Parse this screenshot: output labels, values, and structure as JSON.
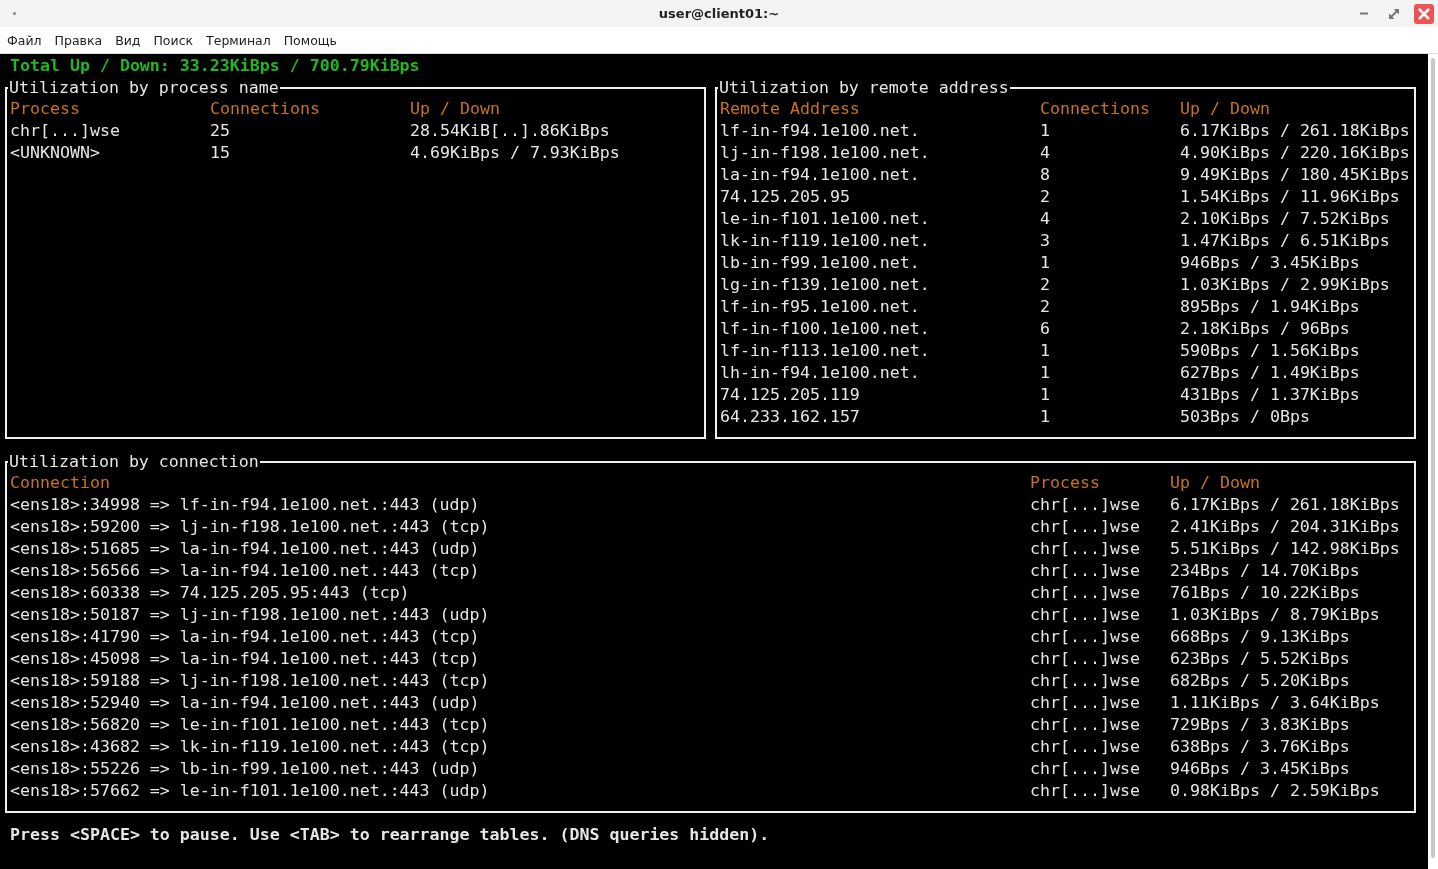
{
  "window": {
    "title": "user@client01:~"
  },
  "menu": [
    "Файл",
    "Правка",
    "Вид",
    "Поиск",
    "Терминал",
    "Помощь"
  ],
  "total": "Total Up / Down: 33.23KiBps / 700.79KiBps",
  "process_panel": {
    "title": "Utilization by process name",
    "columns": [
      "Process",
      "Connections",
      "Up / Down"
    ],
    "rows": [
      [
        "chr[...]wse",
        "25",
        "28.54KiB[..].86KiBps"
      ],
      [
        "<UNKNOWN>",
        "15",
        "4.69KiBps / 7.93KiBps"
      ]
    ]
  },
  "remote_panel": {
    "title": "Utilization by remote address",
    "columns": [
      "Remote Address",
      "Connections",
      "Up / Down"
    ],
    "rows": [
      [
        "lf-in-f94.1e100.net.",
        "1",
        "6.17KiBps / 261.18KiBps"
      ],
      [
        "lj-in-f198.1e100.net.",
        "4",
        "4.90KiBps / 220.16KiBps"
      ],
      [
        "la-in-f94.1e100.net.",
        "8",
        "9.49KiBps / 180.45KiBps"
      ],
      [
        "74.125.205.95",
        "2",
        "1.54KiBps / 11.96KiBps"
      ],
      [
        "le-in-f101.1e100.net.",
        "4",
        "2.10KiBps / 7.52KiBps"
      ],
      [
        "lk-in-f119.1e100.net.",
        "3",
        "1.47KiBps / 6.51KiBps"
      ],
      [
        "lb-in-f99.1e100.net.",
        "1",
        "946Bps / 3.45KiBps"
      ],
      [
        "lg-in-f139.1e100.net.",
        "2",
        "1.03KiBps / 2.99KiBps"
      ],
      [
        "lf-in-f95.1e100.net.",
        "2",
        "895Bps / 1.94KiBps"
      ],
      [
        "lf-in-f100.1e100.net.",
        "6",
        "2.18KiBps / 96Bps"
      ],
      [
        "lf-in-f113.1e100.net.",
        "1",
        "590Bps / 1.56KiBps"
      ],
      [
        "lh-in-f94.1e100.net.",
        "1",
        "627Bps / 1.49KiBps"
      ],
      [
        "74.125.205.119",
        "1",
        "431Bps / 1.37KiBps"
      ],
      [
        "64.233.162.157",
        "1",
        "503Bps / 0Bps"
      ]
    ]
  },
  "connection_panel": {
    "title": "Utilization by connection",
    "columns": [
      "Connection",
      "Process",
      "Up / Down"
    ],
    "rows": [
      [
        "<ens18>:34998 => lf-in-f94.1e100.net.:443 (udp)",
        "chr[...]wse",
        "6.17KiBps / 261.18KiBps"
      ],
      [
        "<ens18>:59200 => lj-in-f198.1e100.net.:443 (tcp)",
        "chr[...]wse",
        "2.41KiBps / 204.31KiBps"
      ],
      [
        "<ens18>:51685 => la-in-f94.1e100.net.:443 (udp)",
        "chr[...]wse",
        "5.51KiBps / 142.98KiBps"
      ],
      [
        "<ens18>:56566 => la-in-f94.1e100.net.:443 (tcp)",
        "chr[...]wse",
        "234Bps / 14.70KiBps"
      ],
      [
        "<ens18>:60338 => 74.125.205.95:443 (tcp)",
        "chr[...]wse",
        "761Bps / 10.22KiBps"
      ],
      [
        "<ens18>:50187 => lj-in-f198.1e100.net.:443 (udp)",
        "chr[...]wse",
        "1.03KiBps / 8.79KiBps"
      ],
      [
        "<ens18>:41790 => la-in-f94.1e100.net.:443 (tcp)",
        "chr[...]wse",
        "668Bps / 9.13KiBps"
      ],
      [
        "<ens18>:45098 => la-in-f94.1e100.net.:443 (tcp)",
        "chr[...]wse",
        "623Bps / 5.52KiBps"
      ],
      [
        "<ens18>:59188 => lj-in-f198.1e100.net.:443 (tcp)",
        "chr[...]wse",
        "682Bps / 5.20KiBps"
      ],
      [
        "<ens18>:52940 => la-in-f94.1e100.net.:443 (udp)",
        "chr[...]wse",
        "1.11KiBps / 3.64KiBps"
      ],
      [
        "<ens18>:56820 => le-in-f101.1e100.net.:443 (tcp)",
        "chr[...]wse",
        "729Bps / 3.83KiBps"
      ],
      [
        "<ens18>:43682 => lk-in-f119.1e100.net.:443 (tcp)",
        "chr[...]wse",
        "638Bps / 3.76KiBps"
      ],
      [
        "<ens18>:55226 => lb-in-f99.1e100.net.:443 (udp)",
        "chr[...]wse",
        "946Bps / 3.45KiBps"
      ],
      [
        "<ens18>:57662 => le-in-f101.1e100.net.:443 (udp)",
        "chr[...]wse",
        "0.98KiBps / 2.59KiBps"
      ]
    ]
  },
  "footer": "Press <SPACE> to pause. Use <TAB> to rearrange tables. (DNS queries hidden)."
}
